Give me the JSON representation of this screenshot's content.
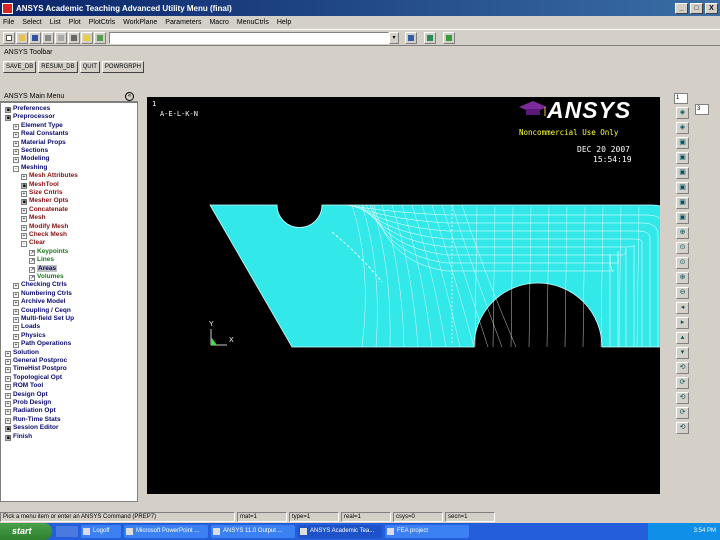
{
  "window": {
    "title": "ANSYS Academic Teaching Advanced Utility Menu (final)",
    "controls": [
      "_",
      "□",
      "X"
    ]
  },
  "menubar": [
    "File",
    "Select",
    "List",
    "Plot",
    "PlotCtrls",
    "WorkPlane",
    "Parameters",
    "Macro",
    "MenuCtrls",
    "Help"
  ],
  "toolbar": {
    "command_value": "",
    "dropdown_glyph": "▾"
  },
  "ansys_toolbar": {
    "title": "ANSYS Toolbar",
    "buttons": [
      "SAVE_DB",
      "RESUM_DB",
      "QUIT",
      "POWRGRPH"
    ]
  },
  "main_menu": {
    "title": "ANSYS Main Menu",
    "collapse_glyph": "«",
    "items": [
      {
        "label": "Preferences",
        "icon": "▣",
        "color": "c-blue"
      },
      {
        "label": "Preprocessor",
        "icon": "▣",
        "color": "c-blue"
      },
      {
        "label": "Element Type",
        "icon": "+",
        "color": "c-blue"
      },
      {
        "label": "Real Constants",
        "icon": "+",
        "color": "c-blue"
      },
      {
        "label": "Material Props",
        "icon": "+",
        "color": "c-blue"
      },
      {
        "label": "Sections",
        "icon": "+",
        "color": "c-blue"
      },
      {
        "label": "Modeling",
        "icon": "+",
        "color": "c-blue"
      },
      {
        "label": "Meshing",
        "icon": "-",
        "color": "c-blue"
      },
      {
        "label": "Mesh Attributes",
        "icon": "+",
        "color": "c-red"
      },
      {
        "label": "MeshTool",
        "icon": "▣",
        "color": "c-red"
      },
      {
        "label": "Size Cntrls",
        "icon": "+",
        "color": "c-red"
      },
      {
        "label": "Mesher Opts",
        "icon": "▣",
        "color": "c-red"
      },
      {
        "label": "Concatenate",
        "icon": "+",
        "color": "c-red"
      },
      {
        "label": "Mesh",
        "icon": "+",
        "color": "c-red"
      },
      {
        "label": "Modify Mesh",
        "icon": "+",
        "color": "c-red"
      },
      {
        "label": "Check Mesh",
        "icon": "+",
        "color": "c-red"
      },
      {
        "label": "Clear",
        "icon": "-",
        "color": "c-red"
      },
      {
        "label": "Keypoints",
        "icon": "↗",
        "color": "c-green"
      },
      {
        "label": "Lines",
        "icon": "↗",
        "color": "c-green"
      },
      {
        "label": "Areas",
        "icon": "↗",
        "color": "c-blue",
        "selected": true
      },
      {
        "label": "Volumes",
        "icon": "↗",
        "color": "c-green"
      },
      {
        "label": "Checking Ctrls",
        "icon": "+",
        "color": "c-blue"
      },
      {
        "label": "Numbering Ctrls",
        "icon": "+",
        "color": "c-blue"
      },
      {
        "label": "Archive Model",
        "icon": "+",
        "color": "c-blue"
      },
      {
        "label": "Coupling / Ceqn",
        "icon": "+",
        "color": "c-blue"
      },
      {
        "label": "Multi-field Set Up",
        "icon": "+",
        "color": "c-blue"
      },
      {
        "label": "Loads",
        "icon": "+",
        "color": "c-blue"
      },
      {
        "label": "Physics",
        "icon": "+",
        "color": "c-blue"
      },
      {
        "label": "Path Operations",
        "icon": "+",
        "color": "c-blue"
      },
      {
        "label": "Solution",
        "icon": "+",
        "color": "c-blue"
      },
      {
        "label": "General Postproc",
        "icon": "+",
        "color": "c-blue"
      },
      {
        "label": "TimeHist Postpro",
        "icon": "+",
        "color": "c-blue"
      },
      {
        "label": "Topological Opt",
        "icon": "+",
        "color": "c-blue"
      },
      {
        "label": "ROM Tool",
        "icon": "+",
        "color": "c-blue"
      },
      {
        "label": "Design Opt",
        "icon": "+",
        "color": "c-blue"
      },
      {
        "label": "Prob Design",
        "icon": "+",
        "color": "c-blue"
      },
      {
        "label": "Radiation Opt",
        "icon": "+",
        "color": "c-blue"
      },
      {
        "label": "Run-Time Stats",
        "icon": "+",
        "color": "c-blue"
      },
      {
        "label": "Session Editor",
        "icon": "▣",
        "color": "c-blue"
      },
      {
        "label": "Finish",
        "icon": "▣",
        "color": "c-blue"
      }
    ]
  },
  "graphics": {
    "window_number": "1",
    "plot_label": "A-E-L-K-N",
    "brand": "ANSYS",
    "notice": "Noncommercial Use Only",
    "date": "DEC 20 2007",
    "time": "15:54:19",
    "axis_y": "Y",
    "axis_x": "X",
    "mesh_color": "#33e8e8"
  },
  "right_toolbar": {
    "select1": "1",
    "select2": "3"
  },
  "statusbar": {
    "prompt": "Pick a menu item or enter an ANSYS Command (PREP7)",
    "fields": [
      "mat=1",
      "type=1",
      "real=1",
      "csys=0",
      "secn=1"
    ]
  },
  "taskbar": {
    "start": "start",
    "tasks": [
      "Logoff",
      "Microsoft PowerPoint ...",
      "ANSYS 11.0 Output ...",
      "ANSYS Academic Tea...",
      "FEA project"
    ],
    "clock": "3:54 PM"
  }
}
